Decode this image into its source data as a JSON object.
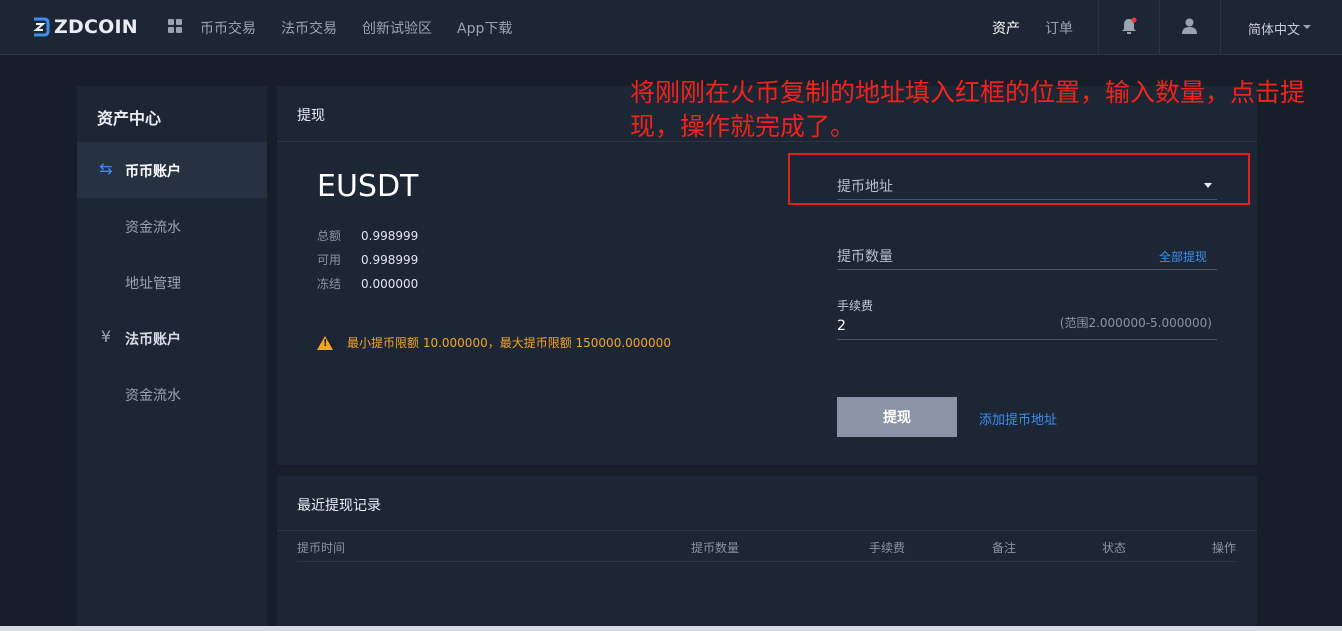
{
  "brand": {
    "name": "ZDCOIN",
    "accent": "#3d8ef0"
  },
  "nav": {
    "left": [
      "币币交易",
      "法币交易",
      "创新试验区",
      "App下载"
    ],
    "assets": "资产",
    "orders": "订单",
    "language": "简体中文"
  },
  "sidebar": {
    "title": "资产中心",
    "items": [
      {
        "label": "币币账户",
        "icon": "exchange-arrows-icon"
      },
      {
        "label": "资金流水"
      },
      {
        "label": "地址管理"
      },
      {
        "label": "法币账户",
        "icon": "yen-icon"
      },
      {
        "label": "资金流水"
      }
    ]
  },
  "withdraw": {
    "title": "提现",
    "coin": "EUSDT",
    "balances": [
      {
        "label": "总额",
        "value": "0.998999"
      },
      {
        "label": "可用",
        "value": "0.998999"
      },
      {
        "label": "冻结",
        "value": "0.000000"
      }
    ],
    "warning": "最小提币限额 10.000000，最大提币限额 150000.000000",
    "address_placeholder": "提币地址",
    "amount_placeholder": "提币数量",
    "all_label": "全部提现",
    "fee_label": "手续费",
    "fee_value": "2",
    "fee_range": "(范围2.000000-5.000000)",
    "submit_label": "提现",
    "add_address_label": "添加提币地址"
  },
  "annotation": {
    "text": "将刚刚在火币复制的地址填入红框的位置，输入数量，点击提现，操作就完成了。",
    "color": "#f2221c"
  },
  "records": {
    "title": "最近提现记录",
    "columns": [
      "提币时间",
      "提币数量",
      "手续费",
      "备注",
      "状态",
      "操作"
    ]
  }
}
